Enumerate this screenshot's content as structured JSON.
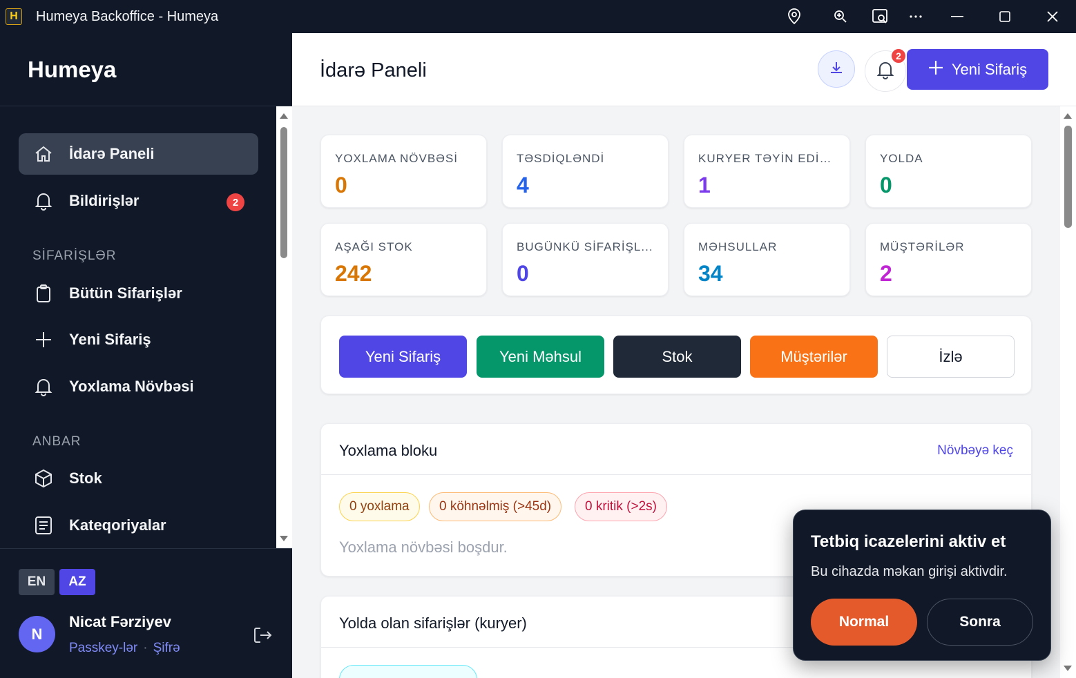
{
  "window": {
    "logo_letter": "H",
    "title": "Humeya Backoffice - Humeya",
    "controls": [
      "location-icon",
      "zoom-icon",
      "cast-icon",
      "more-icon",
      "minimize-icon",
      "maximize-icon",
      "close-icon"
    ]
  },
  "sidebar": {
    "brand": "Humeya",
    "items": [
      {
        "label": "İdarə Paneli",
        "icon": "home-icon",
        "active": true
      },
      {
        "label": "Bildirişlər",
        "icon": "bell-icon",
        "badge": "2"
      },
      {
        "label": "Bütün Sifarişlər",
        "icon": "clipboard-icon"
      },
      {
        "label": "Yeni Sifariş",
        "icon": "plus-icon"
      },
      {
        "label": "Yoxlama Növbəsi",
        "icon": "bell-icon"
      },
      {
        "label": "Stok",
        "icon": "box-icon"
      },
      {
        "label": "Kateqoriyalar",
        "icon": "list-icon"
      }
    ],
    "sections": {
      "orders": "SİFARİŞLƏR",
      "warehouse": "ANBAR"
    },
    "languages": {
      "en": "EN",
      "az": "AZ",
      "selected": "AZ"
    },
    "user": {
      "initial": "N",
      "name": "Nicat Fərziyev",
      "passkeys_link": "Passkey-lər",
      "separator": "·",
      "password_link": "Şifrə"
    }
  },
  "header": {
    "title": "İdarə Paneli",
    "bell_badge": "2",
    "new_order_label": "Yeni Sifariş"
  },
  "stats": [
    {
      "label": "YOXLAMA NÖVBƏSİ",
      "value": "0",
      "color": "#d97706"
    },
    {
      "label": "TƏSDİQLƏNDİ",
      "value": "4",
      "color": "#2563eb"
    },
    {
      "label": "KURYER TƏYİN EDİLDİ",
      "value": "1",
      "color": "#7c3aed"
    },
    {
      "label": "YOLDA",
      "value": "0",
      "color": "#059669"
    },
    {
      "label": "AŞAĞI STOK",
      "value": "242",
      "color": "#d97706"
    },
    {
      "label": "BUGÜNKÜ SİFARİŞL...",
      "value": "0",
      "color": "#4f46e5"
    },
    {
      "label": "MƏHSULLAR",
      "value": "34",
      "color": "#0284c7"
    },
    {
      "label": "MÜŞTƏRİLƏR",
      "value": "2",
      "color": "#c026d3"
    }
  ],
  "quick_actions": [
    {
      "label": "Yeni Sifariş",
      "color": "#4f46e5"
    },
    {
      "label": "Yeni Məhsul",
      "color": "#059669"
    },
    {
      "label": "Stok",
      "color": "#1f2937"
    },
    {
      "label": "Müştərilər",
      "color": "#f97316"
    },
    {
      "label": "İzlə",
      "color": "#ffffff"
    }
  ],
  "review_block": {
    "title": "Yoxlama bloku",
    "link": "Növbəyə keç",
    "pills": [
      "0 yoxlama",
      "0 köhnəlmiş (>45d)",
      "0 kritik (>2s)"
    ],
    "empty": "Yoxlama növbəsi boşdur."
  },
  "transit_block": {
    "title": "Yolda olan sifarişlər (kuryer)"
  },
  "toast": {
    "title": "Tetbiq icazelerini aktiv et",
    "message": "Bu cihazda məkan girişi aktivdir.",
    "primary_label": "Normal",
    "secondary_label": "Sonra"
  }
}
